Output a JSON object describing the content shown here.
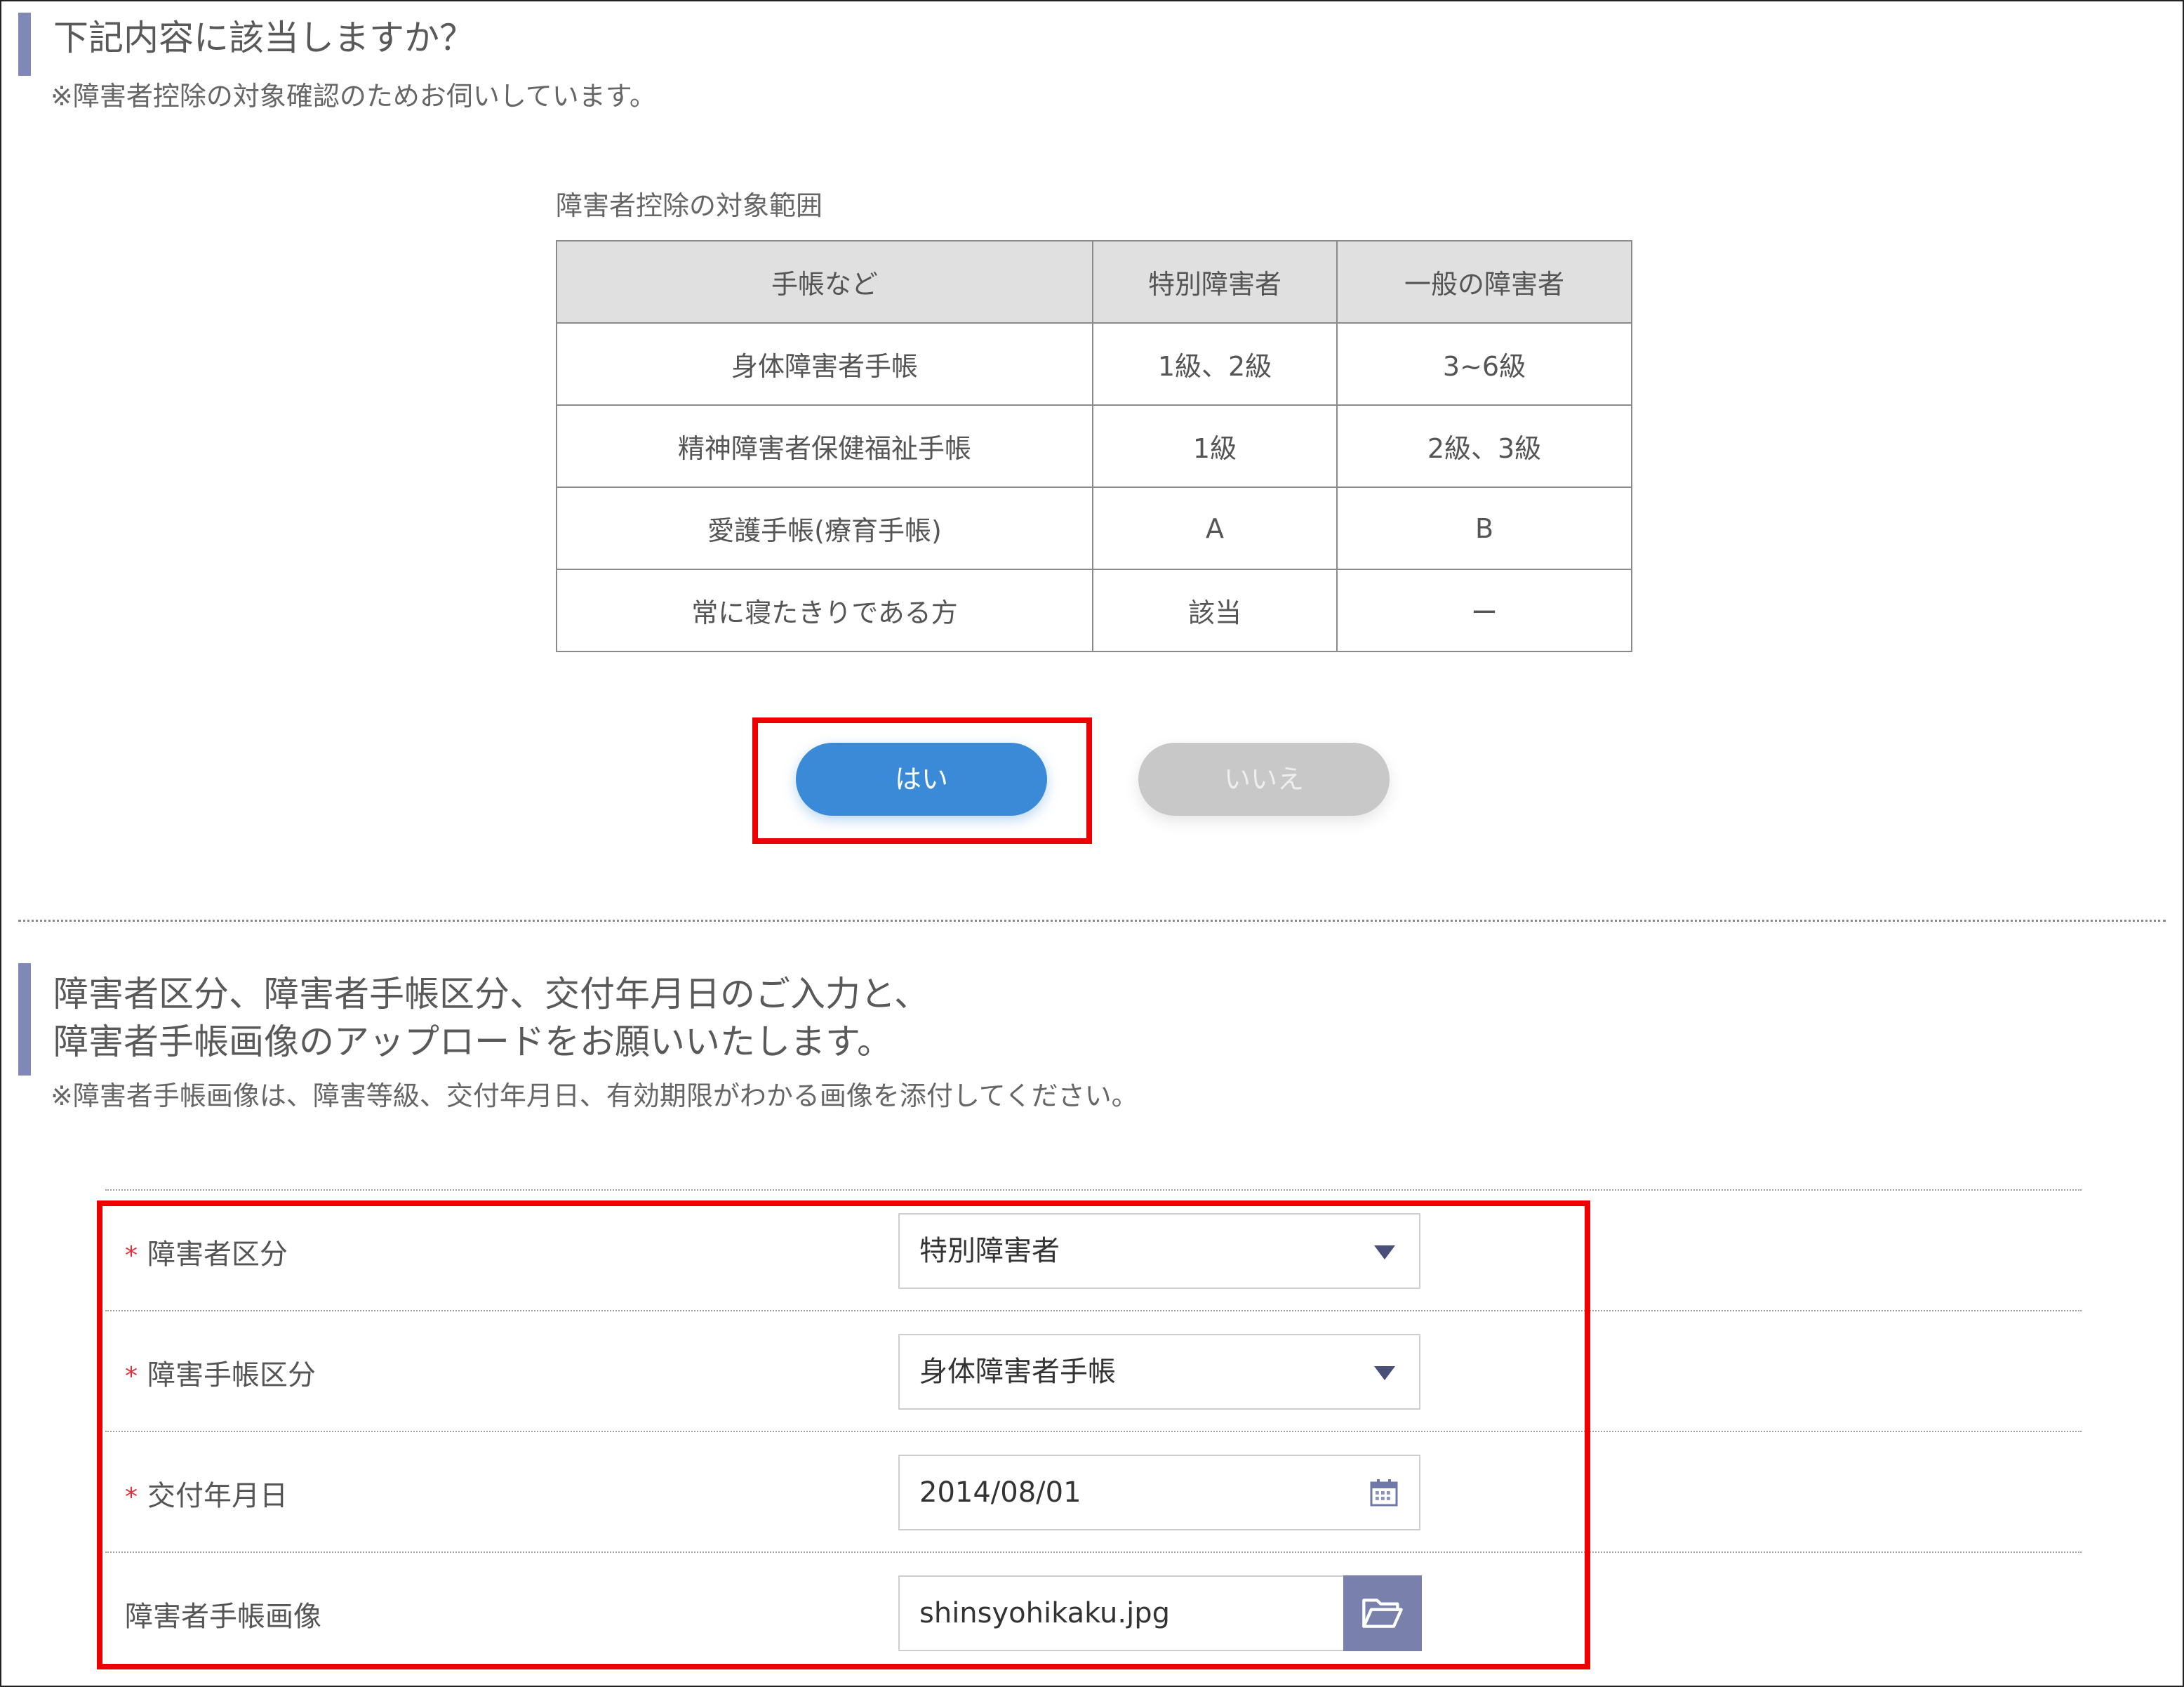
{
  "section1": {
    "heading": "下記内容に該当しますか？",
    "note": "※障害者控除の対象確認のためお伺いしています。"
  },
  "scope_table": {
    "caption": "障害者控除の対象範囲",
    "headers": [
      "手帳など",
      "特別障害者",
      "一般の障害者"
    ],
    "rows": [
      [
        "身体障害者手帳",
        "1級、2級",
        "3~6級"
      ],
      [
        "精神障害者保健福祉手帳",
        "1級",
        "2級、3級"
      ],
      [
        "愛護手帳(療育手帳)",
        "A",
        "B"
      ],
      [
        "常に寝たきりである方",
        "該当",
        "ー"
      ]
    ]
  },
  "buttons": {
    "yes": "はい",
    "no": "いいえ"
  },
  "section2": {
    "heading_line1": "障害者区分、障害者手帳区分、交付年月日のご入力と、",
    "heading_line2": "障害者手帳画像のアップロードをお願いいたします。",
    "note": "※障害者手帳画像は、障害等級、交付年月日、有効期限がわかる画像を添付してください。"
  },
  "form": {
    "required_mark": "*",
    "disability_class": {
      "label": "障害者区分",
      "value": "特別障害者"
    },
    "handbook_class": {
      "label": "障害手帳区分",
      "value": "身体障害者手帳"
    },
    "issue_date": {
      "label": "交付年月日",
      "value": "2014/08/01"
    },
    "handbook_image": {
      "label": "障害者手帳画像",
      "value": "shinsyohikaku.jpg"
    }
  },
  "colors": {
    "accent": "#8088b8",
    "primary": "#3a8ad8",
    "highlight": "#ee0000",
    "disabled": "#c8c8c8"
  }
}
